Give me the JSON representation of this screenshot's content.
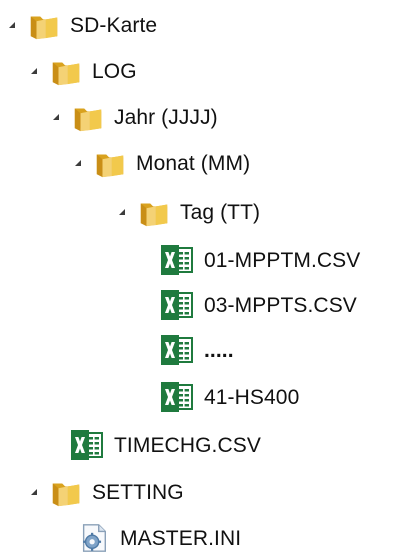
{
  "colors": {
    "folder_front": "#f2c94c",
    "folder_back": "#d9a21e",
    "excel_green": "#1f7a3e",
    "arrow": "#3c3c3c",
    "text": "#111111"
  },
  "tree": {
    "sd_card": {
      "label": "SD-Karte",
      "icon": "folder-icon",
      "expanded": true
    },
    "log": {
      "label": "LOG",
      "icon": "folder-icon",
      "expanded": true
    },
    "year": {
      "label": "Jahr (JJJJ)",
      "icon": "folder-icon",
      "expanded": true
    },
    "month": {
      "label": "Monat (MM)",
      "icon": "folder-icon",
      "expanded": true
    },
    "day": {
      "label": "Tag (TT)",
      "icon": "folder-icon",
      "expanded": true
    },
    "file_01": {
      "label": "01-MPPTM.CSV",
      "icon": "excel-icon"
    },
    "file_03": {
      "label": "03-MPPTS.CSV",
      "icon": "excel-icon"
    },
    "file_more": {
      "label": ".....",
      "icon": "excel-icon"
    },
    "file_41": {
      "label": "41-HS400",
      "icon": "excel-icon"
    },
    "timechg": {
      "label": "TIMECHG.CSV",
      "icon": "excel-icon"
    },
    "setting": {
      "label": "SETTING",
      "icon": "folder-icon",
      "expanded": true
    },
    "master": {
      "label": "MASTER.INI",
      "icon": "settings-file-icon"
    }
  }
}
